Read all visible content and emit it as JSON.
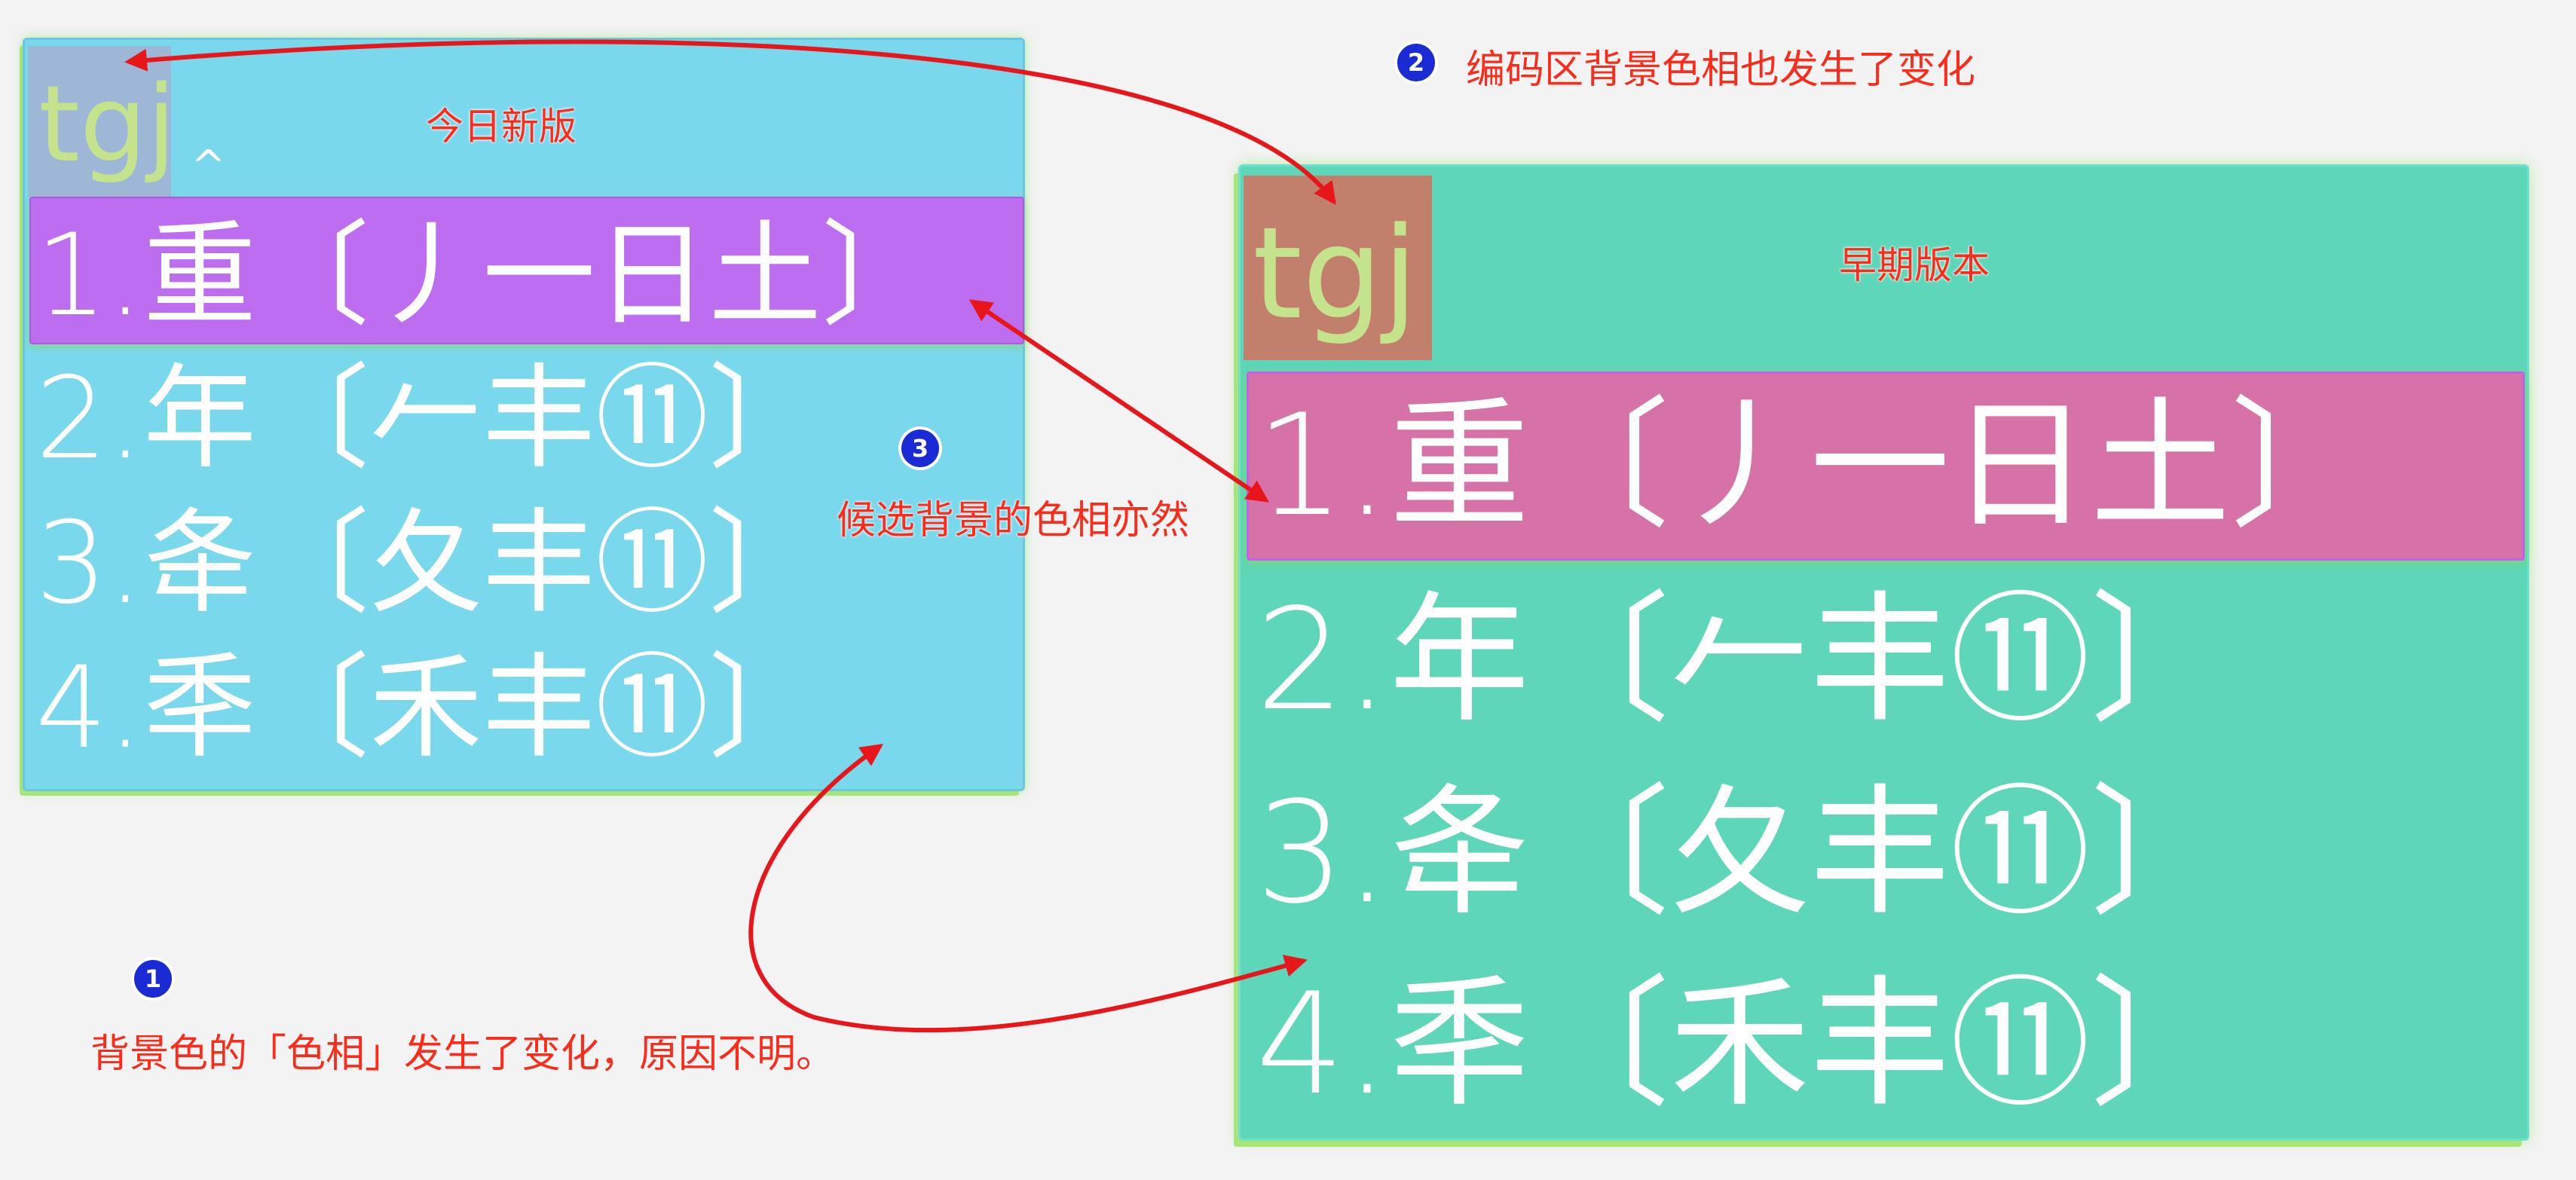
{
  "panels": {
    "new": {
      "title": "今日新版",
      "code": "tgj",
      "caret": "^",
      "candidates": [
        "1.重〔丿一日土〕",
        "2.年〔𠂉丰⑪〕",
        "3.夅〔夂丰⑪〕",
        "4.秊〔禾丰⑪〕"
      ],
      "colors": {
        "background": "#7ad8ec",
        "code_bg": "#9fb7d6",
        "highlight": "#bd6df0"
      }
    },
    "old": {
      "title": "早期版本",
      "code": "tgj",
      "candidates": [
        "1.重〔丿一日土〕",
        "2.年〔𠂉丰⑪〕",
        "3.夅〔夂丰⑪〕",
        "4.秊〔禾丰⑪〕"
      ],
      "colors": {
        "background": "#5dd6b9",
        "code_bg": "#c2806c",
        "highlight": "#d672a8"
      }
    }
  },
  "notes": [
    {
      "number": "1",
      "text": "背景色的「色相」发生了变化，原因不明。"
    },
    {
      "number": "2",
      "text": "编码区背景色相也发生了变化"
    },
    {
      "number": "3",
      "text": "候选背景的色相亦然"
    }
  ],
  "colors": {
    "annotation": "#ff2a1a",
    "badge": "#1a2bd6",
    "page": "#f3f3f3"
  }
}
